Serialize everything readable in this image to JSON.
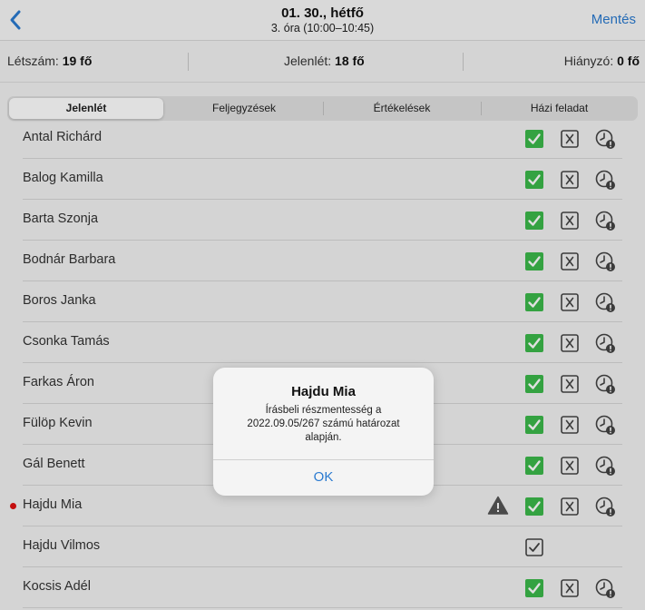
{
  "header": {
    "title": "01. 30., hétfő",
    "subtitle": "3. óra (10:00–10:45)",
    "save_label": "Mentés"
  },
  "stats": {
    "count_label": "Létszám:",
    "count_value": "19 fő",
    "present_label": "Jelenlét:",
    "present_value": "18 fő",
    "absent_label": "Hiányzó:",
    "absent_value": "0 fő"
  },
  "tabs": [
    "Jelenlét",
    "Feljegyzések",
    "Értékelések",
    "Házi feladat"
  ],
  "students": [
    {
      "name": "Antal Richárd"
    },
    {
      "name": "Balog Kamilla"
    },
    {
      "name": "Barta Szonja"
    },
    {
      "name": "Bodnár Barbara"
    },
    {
      "name": "Boros Janka"
    },
    {
      "name": "Csonka Tamás"
    },
    {
      "name": "Farkas Áron"
    },
    {
      "name": "Fülöp Kevin"
    },
    {
      "name": "Gál Benett"
    },
    {
      "name": "Hajdu Mia"
    },
    {
      "name": "Hajdu Vilmos"
    },
    {
      "name": "Kocsis Adél"
    }
  ],
  "alert": {
    "title": "Hajdu Mia",
    "message": "Írásbeli részmentesség a 2022.09.05/267 számú határozat alapján.",
    "ok_label": "OK"
  },
  "colors": {
    "accent": "#2a7ad0",
    "present_green": "#3cb94a",
    "marker_red": "#e01010"
  }
}
